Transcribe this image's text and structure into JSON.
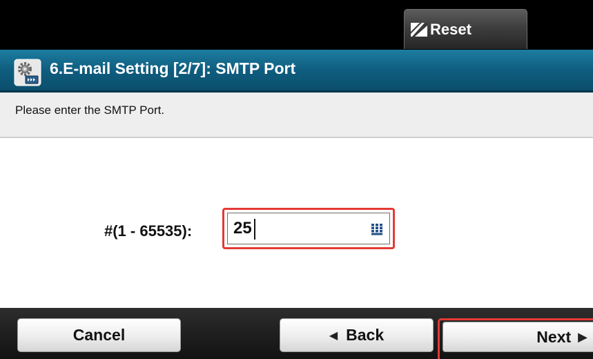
{
  "header": {
    "reset_label": "Reset",
    "title": "6.E-mail Setting [2/7]: SMTP Port"
  },
  "instruction": "Please enter the SMTP Port.",
  "form": {
    "port_label": "#(1 - 65535):",
    "port_value": "25"
  },
  "footer": {
    "cancel_label": "Cancel",
    "back_label": "Back",
    "next_label": "Next"
  },
  "icons": {
    "reset": "reset-icon",
    "title": "settings-gear-icon",
    "keypad": "keypad-icon",
    "back": "arrow-left-icon",
    "next": "arrow-right-icon"
  },
  "colors": {
    "title_bar": "#0f5d7f",
    "highlight": "#e53935",
    "top_bar": "#000000"
  }
}
